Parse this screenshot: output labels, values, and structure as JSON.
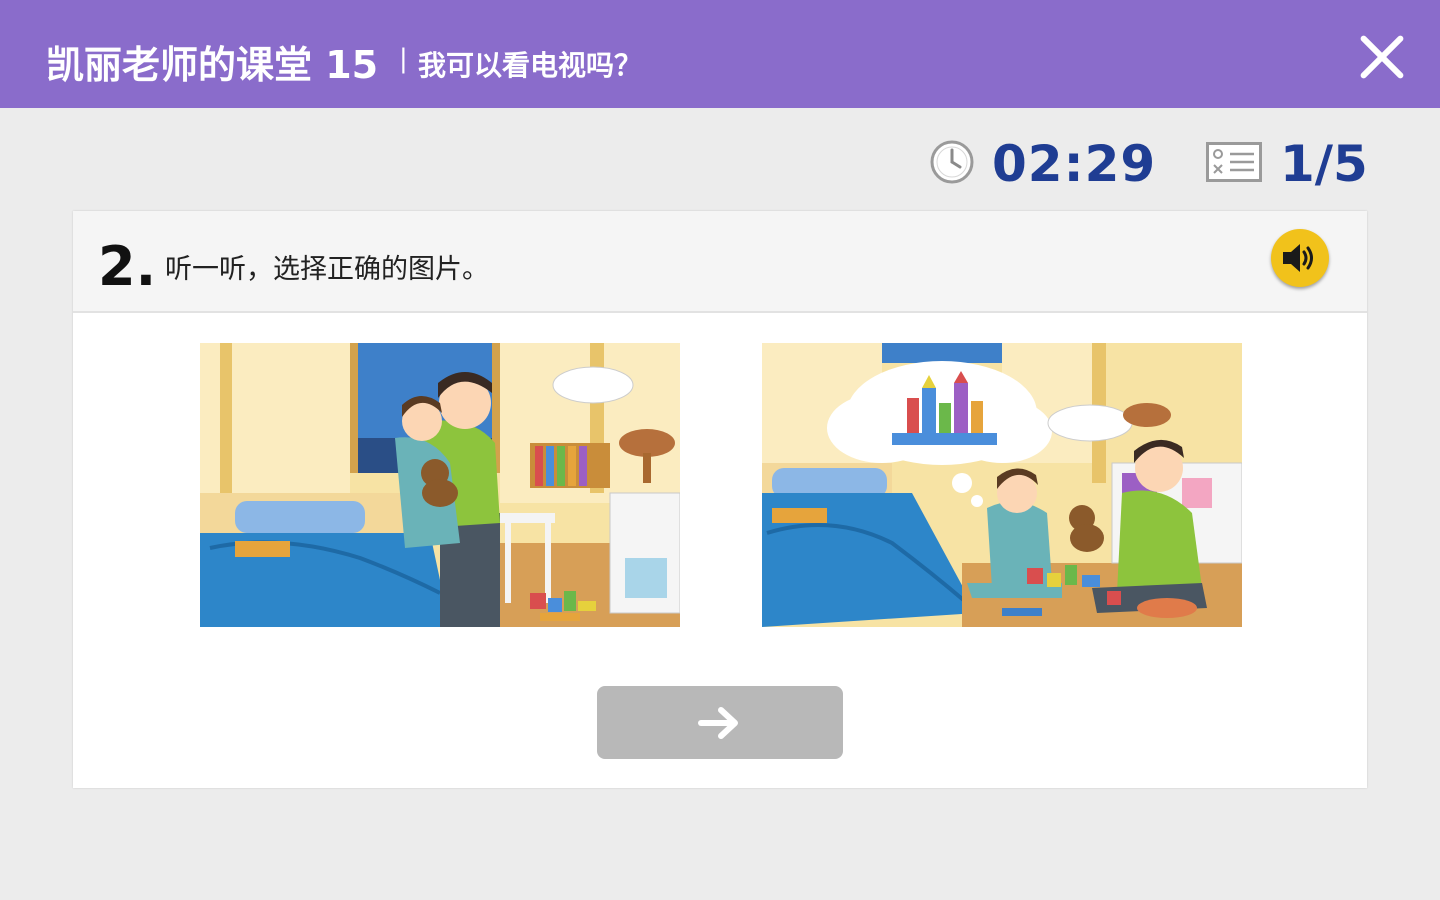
{
  "header": {
    "title": "凯丽老师的课堂 15",
    "separator": "|",
    "subtitle": "我可以看电视吗？"
  },
  "status": {
    "timer": "02:29",
    "progress": "1/5"
  },
  "question": {
    "number": "2.",
    "prompt": "听一听，选择正确的图片。"
  },
  "answer_options": [
    "picture-1",
    "picture-2"
  ],
  "colors": {
    "header_bg": "#8a6ccb",
    "status_text": "#1f3d93",
    "audio_button": "#f1c21b",
    "next_button": "#b8b8b8"
  },
  "icons": [
    "close-icon",
    "clock-icon",
    "quiz-list-icon",
    "speaker-icon",
    "arrow-right-icon"
  ]
}
